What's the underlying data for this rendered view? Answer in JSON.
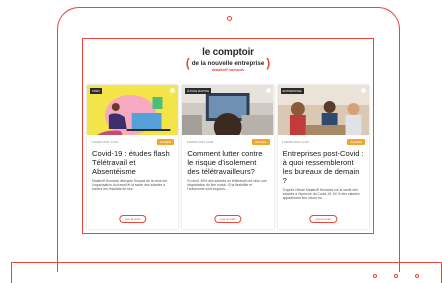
{
  "brand": {
    "title": "le comptoir",
    "subtitle": "de la nouvelle entreprise",
    "owner": "malakoff humanis",
    "accent_color": "#e8473b"
  },
  "cards": [
    {
      "tag": "PRÉV",
      "date": "7 MARS 2021 12:00",
      "badge": "Actualité",
      "title": "Covid-19 : études flash Télétravail et Absentéisme",
      "excerpt": "Malakoff Humanis décrypte l'impact de la crise sur l'organisation du travail et la santé des salariés à travers les résultats de ses...",
      "button": "Lire la suite",
      "image_icon": "illustration-laptop-woman"
    },
    {
      "tag": "ÉTUDE RAPIDE",
      "date": "3 MARS 2021 12:00",
      "badge": "Actualité",
      "title": "Comment lutter contre le risque d'isolement des télétravailleurs?",
      "excerpt": "En avril, 39% des salariés en télétravail ont vécu une dégradation du lien social. Si la flexibilité et l'autonomie sont toujours...",
      "button": "Lire la suite",
      "image_icon": "photo-child-videocall"
    },
    {
      "tag": "ENTREPRISE",
      "date": "3 MARS 2021 12:00",
      "badge": "Actualité",
      "title": "Entreprises post-Covid : à quoi ressembleront les bureaux de demain ?",
      "excerpt": "D'après l'étude Malakoff Humanis sur la santé des salariés à l'épreuve du Covid-19, 64 % des salariés appartenant leur retour en...",
      "button": "Lire la suite",
      "image_icon": "photo-office-meeting"
    }
  ]
}
